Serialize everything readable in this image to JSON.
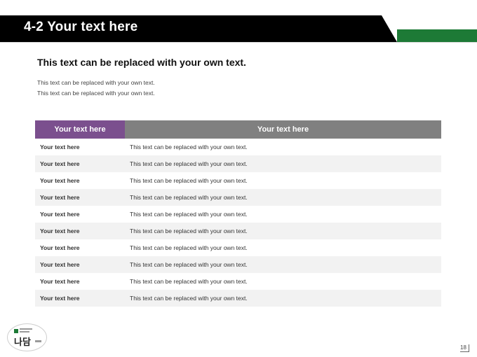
{
  "header": {
    "title": "4-2 Your text here"
  },
  "content": {
    "subtitle": "This text can be replaced with your own text.",
    "lines": [
      "This text can be replaced with your own text.",
      "This text can be replaced with your own text."
    ]
  },
  "table": {
    "headers": [
      "Your text here",
      "Your text here"
    ],
    "rows": [
      [
        "Your text here",
        "This text can be replaced with your own text."
      ],
      [
        "Your text here",
        "This text can be replaced with your own text."
      ],
      [
        "Your text here",
        "This text can be replaced with your own text."
      ],
      [
        "Your text here",
        "This text can be replaced with your own text."
      ],
      [
        "Your text here",
        "This text can be replaced with your own text."
      ],
      [
        "Your text here",
        "This text can be replaced with your own text."
      ],
      [
        "Your text here",
        "This text can be replaced with your own text."
      ],
      [
        "Your text here",
        "This text can be replaced with your own text."
      ],
      [
        "Your text here",
        "This text can be replaced with your own text."
      ],
      [
        "Your text here",
        "This text can be replaced with your own text."
      ]
    ]
  },
  "logo": {
    "text": "나담"
  },
  "footer": {
    "page_number": "18"
  },
  "colors": {
    "header": "#000000",
    "accent_green": "#1d7a36",
    "header_cell_1": "#7b4f8e",
    "header_cell_2": "#808080",
    "row_alt": "#f2f2f2"
  }
}
